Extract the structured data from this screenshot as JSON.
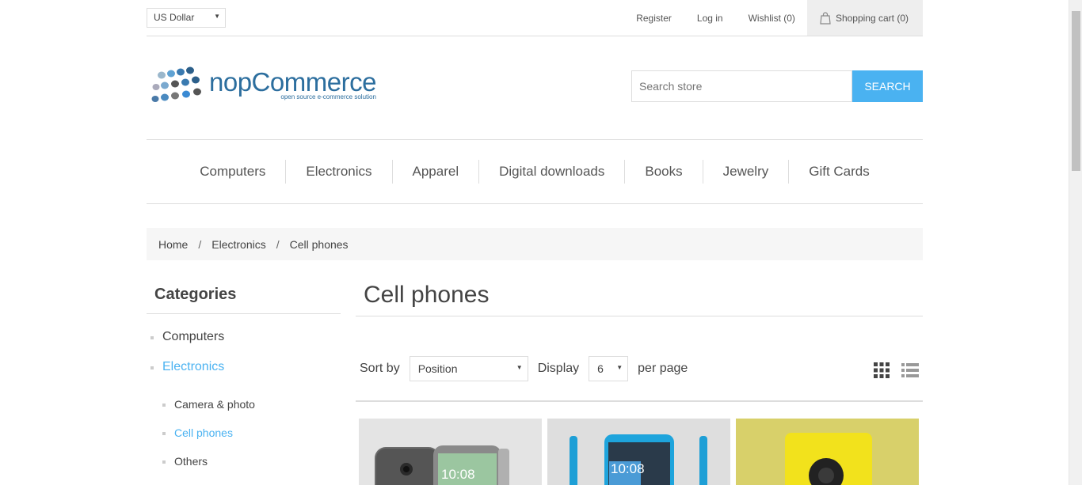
{
  "header": {
    "currency": "US Dollar",
    "links": [
      "Register",
      "Log in",
      "Wishlist (0)"
    ],
    "cart": "Shopping cart (0)"
  },
  "logo": {
    "name": "nopCommerce",
    "tagline": "open source e-commerce solution"
  },
  "search": {
    "placeholder": "Search store",
    "button": "SEARCH"
  },
  "menu": [
    "Computers",
    "Electronics",
    "Apparel",
    "Digital downloads",
    "Books",
    "Jewelry",
    "Gift Cards"
  ],
  "breadcrumb": [
    "Home",
    "Electronics",
    "Cell phones"
  ],
  "sidebar": {
    "title": "Categories",
    "categories": [
      "Computers",
      "Electronics"
    ],
    "subcategories": [
      "Camera & photo",
      "Cell phones",
      "Others"
    ]
  },
  "main": {
    "title": "Cell phones",
    "sort_label": "Sort by",
    "sort_value": "Position",
    "display_label": "Display",
    "display_value": "6",
    "per_page": "per page"
  },
  "products": [
    {
      "screen_time": "10:08"
    },
    {
      "screen_time": "10:08"
    },
    {
      "screen_time": ""
    }
  ],
  "colors": {
    "accent": "#4ab2f1",
    "product_bg_3": "#d8d06a"
  }
}
